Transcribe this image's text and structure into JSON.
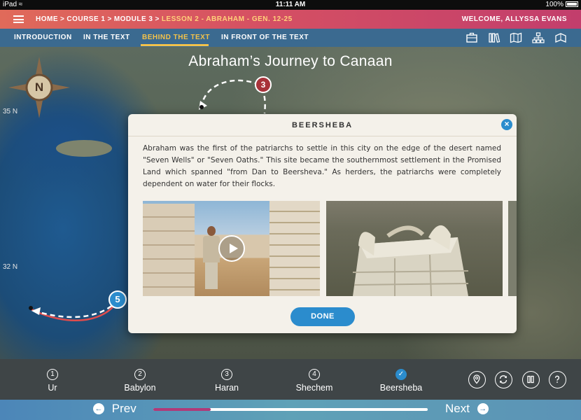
{
  "status_bar": {
    "device": "iPad",
    "time": "11:11 AM",
    "battery": "100%"
  },
  "header": {
    "breadcrumbs": [
      {
        "label": "HOME",
        "current": false
      },
      {
        "label": "COURSE 1",
        "current": false
      },
      {
        "label": "MODULE 3",
        "current": false
      },
      {
        "label": "LESSON 2 - ABRAHAM - GEN. 12-25",
        "current": true
      }
    ],
    "separator": ">",
    "welcome": "WELCOME, ALLYSSA EVANS"
  },
  "tabs": [
    {
      "label": "INTRODUCTION",
      "active": false
    },
    {
      "label": "IN THE TEXT",
      "active": false
    },
    {
      "label": "BEHIND THE TEXT",
      "active": true
    },
    {
      "label": "IN FRONT OF THE TEXT",
      "active": false
    }
  ],
  "toolbar_icons": [
    "briefcase-icon",
    "library-icon",
    "map-icon",
    "hierarchy-icon",
    "book-icon"
  ],
  "map": {
    "title": "Abraham’s Journey to Canaan",
    "compass_label": "N",
    "lat_labels": [
      "35 N",
      "32 N"
    ],
    "markers": [
      {
        "number": "3",
        "color": "#a8323a"
      },
      {
        "number": "5",
        "color": "#2b8ccd"
      }
    ]
  },
  "modal": {
    "title": "BEERSHEBA",
    "close_symbol": "×",
    "body": "Abraham was the first of the patriarchs to settle in this city on the edge of the desert named \"Seven Wells\" or \"Seven Oaths.\" This site became the southernmost settlement in the Promised Land which spanned \"from Dan to Beersheva.\" As herders, the patriarchs were completely dependent on water for their flocks.",
    "done_label": "DONE"
  },
  "steps": [
    {
      "number": "1",
      "label": "Ur",
      "done": false
    },
    {
      "number": "2",
      "label": "Babylon",
      "done": false
    },
    {
      "number": "3",
      "label": "Haran",
      "done": false
    },
    {
      "number": "4",
      "label": "Shechem",
      "done": false
    },
    {
      "number": "✓",
      "label": "Beersheba",
      "done": true
    }
  ],
  "controls": [
    "location-pin-icon",
    "refresh-icon",
    "pause-icon",
    "help-icon"
  ],
  "bottom_nav": {
    "prev_label": "Prev",
    "next_label": "Next",
    "progress": 0.21
  },
  "colors": {
    "accent_blue": "#2b8ccd",
    "active_tab": "#f3c24a",
    "progress_fill": "#b03a78"
  }
}
